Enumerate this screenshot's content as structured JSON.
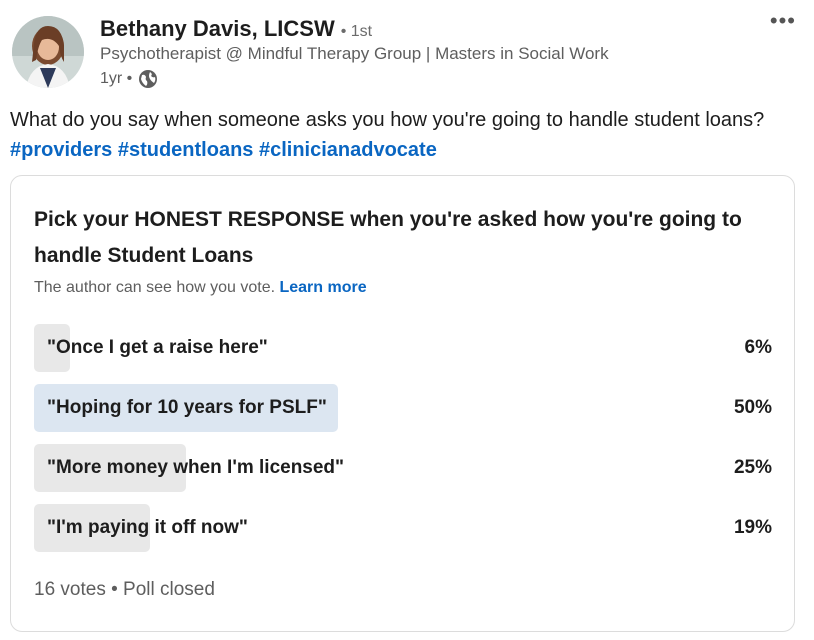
{
  "author": {
    "name": "Bethany Davis, LICSW",
    "degree": "• 1st",
    "headline": "Psychotherapist @ Mindful Therapy Group | Masters in Social Work",
    "time": "1yr •"
  },
  "more_label": "•••",
  "post": {
    "text": "What do you say when someone asks you how you're going to handle student loans? ",
    "hashtags": [
      "#providers",
      "#studentloans",
      "#clinicianadvocate"
    ]
  },
  "poll": {
    "question": "Pick your HONEST RESPONSE when you're asked how you're going to handle Student Loans",
    "note": "The author can see how you vote. ",
    "learn_more": "Learn more",
    "options": [
      {
        "label": "\"Once I get a raise here\"",
        "percent_label": "6%",
        "percent": 6,
        "selected": false
      },
      {
        "label": "\"Hoping for 10 years for PSLF\"",
        "percent_label": "50%",
        "percent": 50,
        "selected": true
      },
      {
        "label": "\"More money when I'm licensed\"",
        "percent_label": "25%",
        "percent": 25,
        "selected": false
      },
      {
        "label": "\"I'm paying it off now\"",
        "percent_label": "19%",
        "percent": 19,
        "selected": false
      }
    ],
    "votes": "16 votes",
    "separator": "•",
    "status": "Poll closed"
  },
  "colors": {
    "link": "#0a66c2",
    "bar": "#e8e8e8",
    "bar_selected": "#dce6f1"
  }
}
